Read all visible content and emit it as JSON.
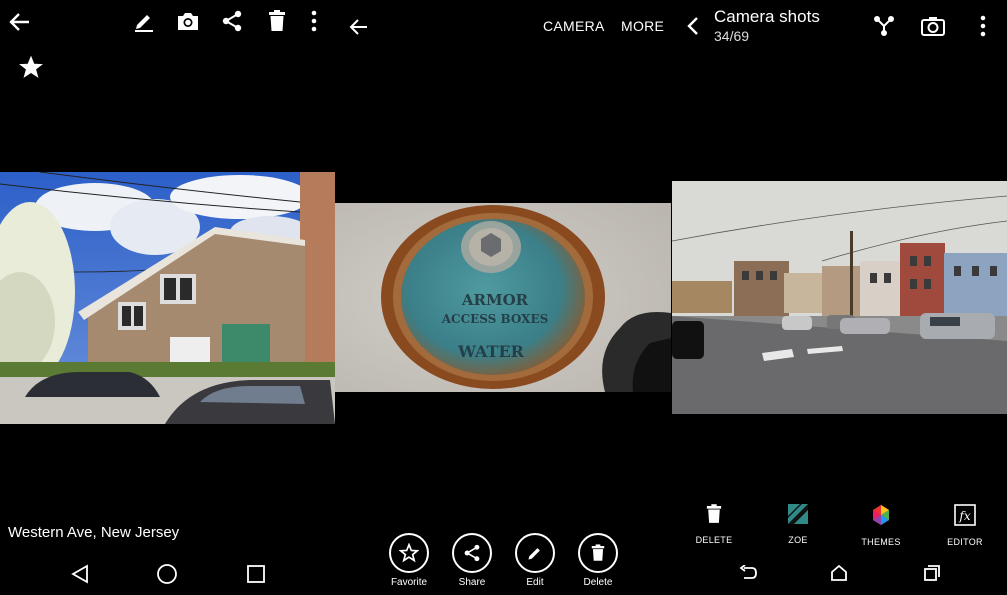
{
  "panel1": {
    "toolbar_icons": [
      "back-arrow-icon",
      "edit-pencil-icon",
      "camera-icon",
      "share-icon",
      "trash-icon",
      "overflow-menu-icon"
    ],
    "favorite_icon": "star-icon",
    "photo_subject": "house-street-photo",
    "location": "Western Ave, New Jersey",
    "nav_icons": [
      "nav-back-icon",
      "nav-home-icon",
      "nav-recents-icon"
    ]
  },
  "panel2": {
    "back_icon": "back-arrow-icon",
    "camera_label": "CAMERA",
    "more_label": "MORE",
    "photo_subject": "manhole-cover-photo",
    "cover_text_line1": "ARMOR",
    "cover_text_line2": "ACCESS BOXES",
    "cover_text_line3": "WATER",
    "actions": [
      {
        "label": "Favorite",
        "icon": "star-outline-icon"
      },
      {
        "label": "Share",
        "icon": "share-icon"
      },
      {
        "label": "Edit",
        "icon": "edit-pencil-icon"
      },
      {
        "label": "Delete",
        "icon": "trash-icon"
      }
    ]
  },
  "panel3": {
    "back_icon": "chevron-left-icon",
    "title": "Camera shots",
    "count": "34/69",
    "header_icons": [
      "share-connect-icon",
      "camera-icon",
      "overflow-menu-icon"
    ],
    "photo_subject": "street-scene-photo",
    "tools": [
      {
        "label": "DELETE",
        "icon": "trash-icon"
      },
      {
        "label": "ZOE",
        "icon": "zoe-icon"
      },
      {
        "label": "THEMES",
        "icon": "themes-icon"
      },
      {
        "label": "EDITOR",
        "icon": "fx-editor-icon"
      }
    ],
    "nav_icons": [
      "nav-back-icon",
      "nav-home-icon",
      "nav-recents-icon"
    ]
  },
  "colors": {
    "background": "#000000",
    "foreground": "#ffffff",
    "sky": "#3d6fd0",
    "siding": "#a08670",
    "rust": "#9a5a2c",
    "teal_paint": "#3d8a90",
    "street_sky": "#d8d8d4"
  }
}
